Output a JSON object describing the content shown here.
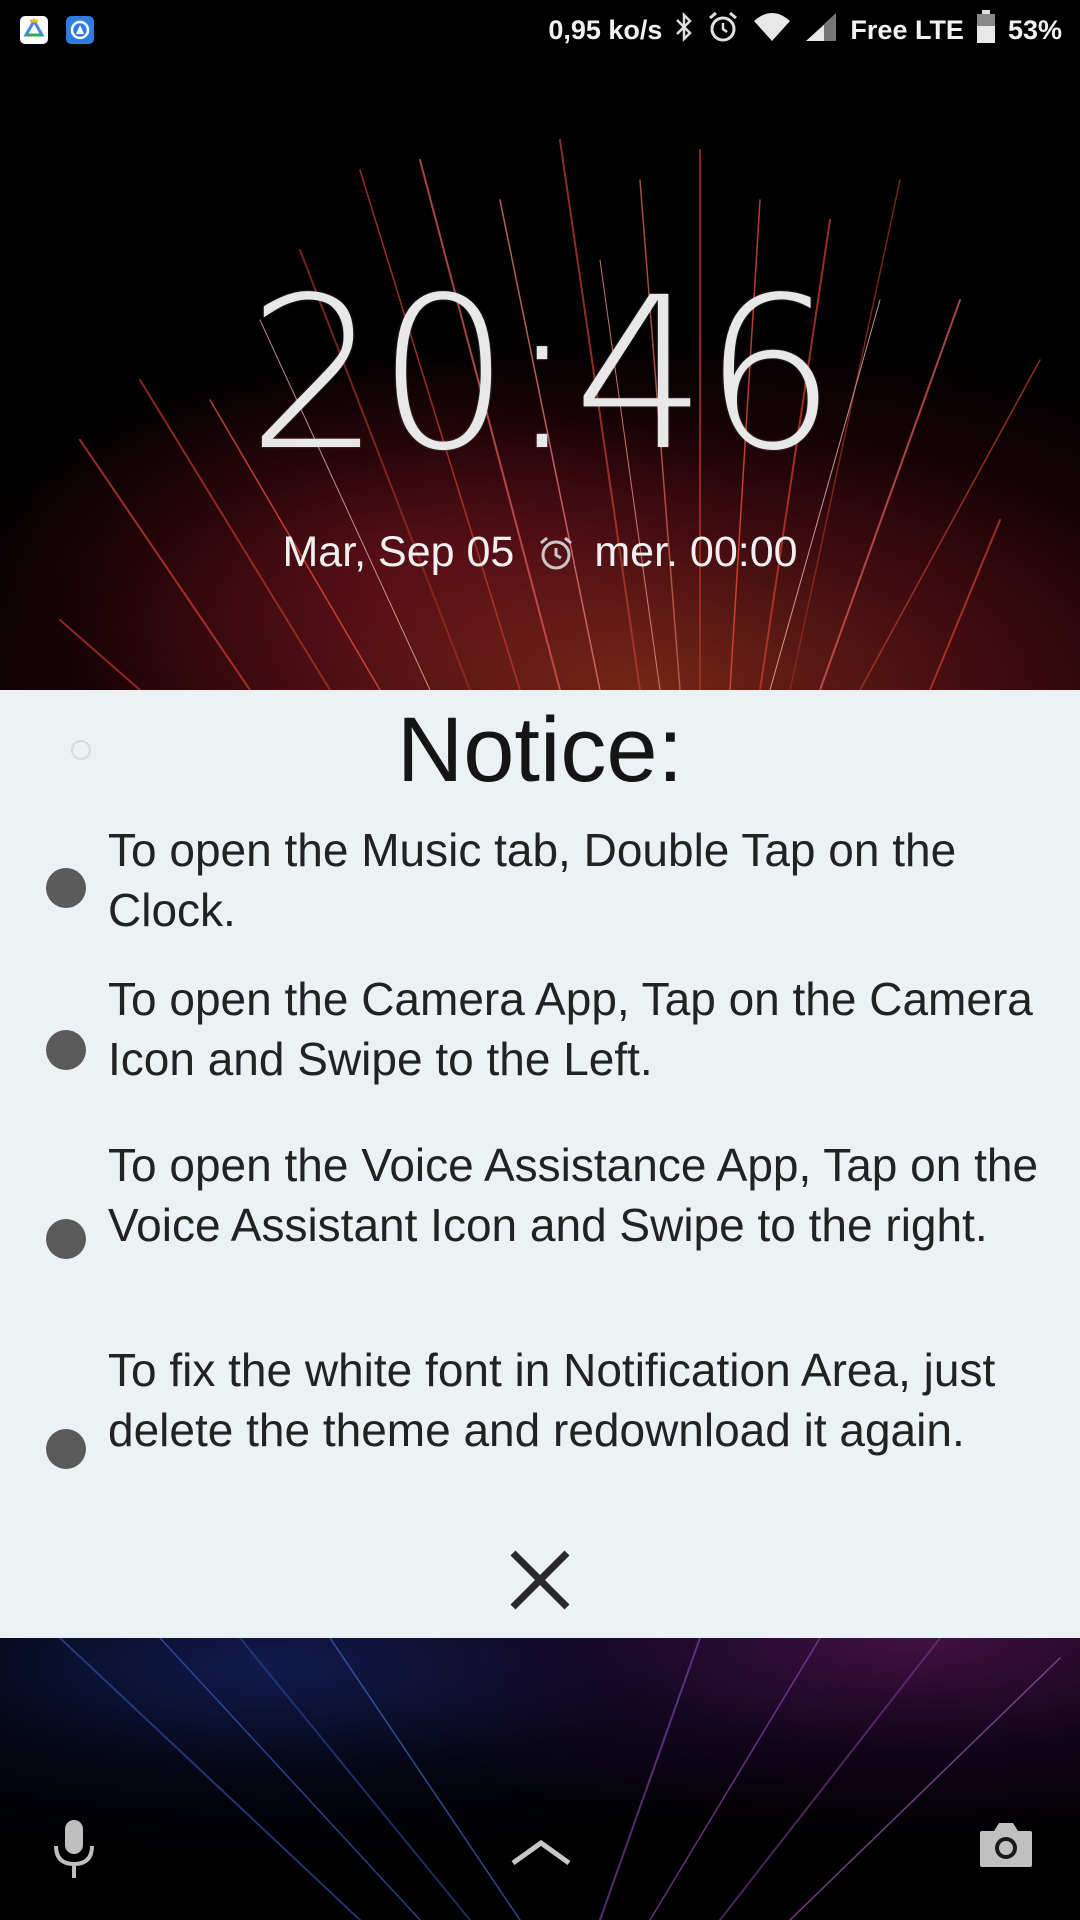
{
  "status_bar": {
    "network_speed": "0,95 ko/s",
    "carrier": "Free LTE",
    "battery": "53%",
    "left_icons": [
      "google-drive-icon",
      "app-drawer-icon"
    ],
    "right_icons": [
      "bluetooth-icon",
      "alarm-icon",
      "wifi-icon",
      "cell-signal-icon",
      "battery-icon"
    ]
  },
  "lockscreen": {
    "time": "20:46",
    "date": "Mar, Sep 05",
    "next_alarm": "mer. 00:00"
  },
  "notice": {
    "title": "Notice:",
    "items": [
      {
        "text": "To open the Music tab, Double Tap on the Clock."
      },
      {
        "text": "To open the Camera App, Tap on the Camera Icon and Swipe to the Left."
      },
      {
        "text": "To open the Voice Assistance App, Tap on the Voice Assistant Icon and Swipe to the right."
      },
      {
        "text": "To fix the white font in Notification Area, just delete the theme and redownload it again."
      }
    ],
    "close_icon": "close-icon"
  },
  "shortcuts": {
    "left_icon": "microphone-icon",
    "center_icon": "chevron-up-icon",
    "right_icon": "camera-icon"
  },
  "colors": {
    "notice_background": "#ecf2f3",
    "bullet": "#5a5a5a",
    "clock_text": "#e8e8e8"
  }
}
